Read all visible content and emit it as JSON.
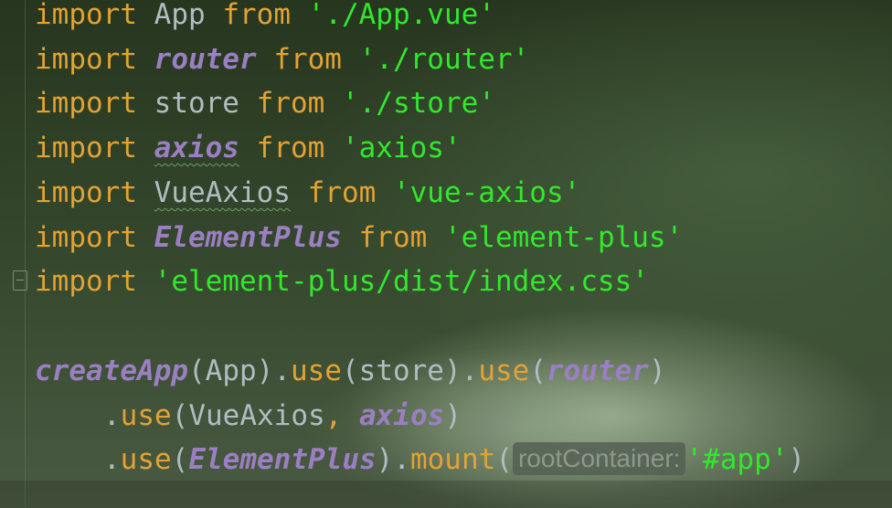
{
  "code": {
    "line1": {
      "kw": "import",
      "name": "App",
      "from": "from",
      "source": "'./App.vue'"
    },
    "line2": {
      "kw": "import",
      "name": "router",
      "from": "from",
      "source": "'./router'"
    },
    "line3": {
      "kw": "import",
      "name": "store",
      "from": "from",
      "source": "'./store'"
    },
    "line4": {
      "kw": "import",
      "name": "axios",
      "from": "from",
      "source": "'axios'"
    },
    "line5": {
      "kw": "import",
      "name": "VueAxios",
      "from": "from",
      "source": "'vue-axios'"
    },
    "line6": {
      "kw": "import",
      "name": "ElementPlus",
      "from": "from",
      "source": "'element-plus'"
    },
    "line7": {
      "kw": "import",
      "source": "'element-plus/dist/index.css'"
    },
    "line8": {
      "fn": "createApp",
      "open1": "(",
      "arg1": "App",
      "close1": ").",
      "use": "use",
      "open2": "(",
      "arg2": "store",
      "close2": ").",
      "use2": "use",
      "open3": "(",
      "arg3": "router",
      "close3": ")"
    },
    "line9": {
      "dot": ".",
      "use": "use",
      "open": "(",
      "arg1": "VueAxios",
      "comma": ",",
      "arg2": "axios",
      "close": ")"
    },
    "line10": {
      "dot": ".",
      "use": "use",
      "open": "(",
      "arg1": "ElementPlus",
      "close": ").",
      "mount": "mount",
      "open2": "(",
      "hint": "rootContainer:",
      "arg2": "'#app'",
      "close2": ")"
    }
  },
  "colors": {
    "keyword": "#e3a233",
    "identifier": "#b2bcc2",
    "italic_identifier": "#9b7fc2",
    "string": "#31e82c",
    "inlay_hint": "#8c9a8c"
  }
}
